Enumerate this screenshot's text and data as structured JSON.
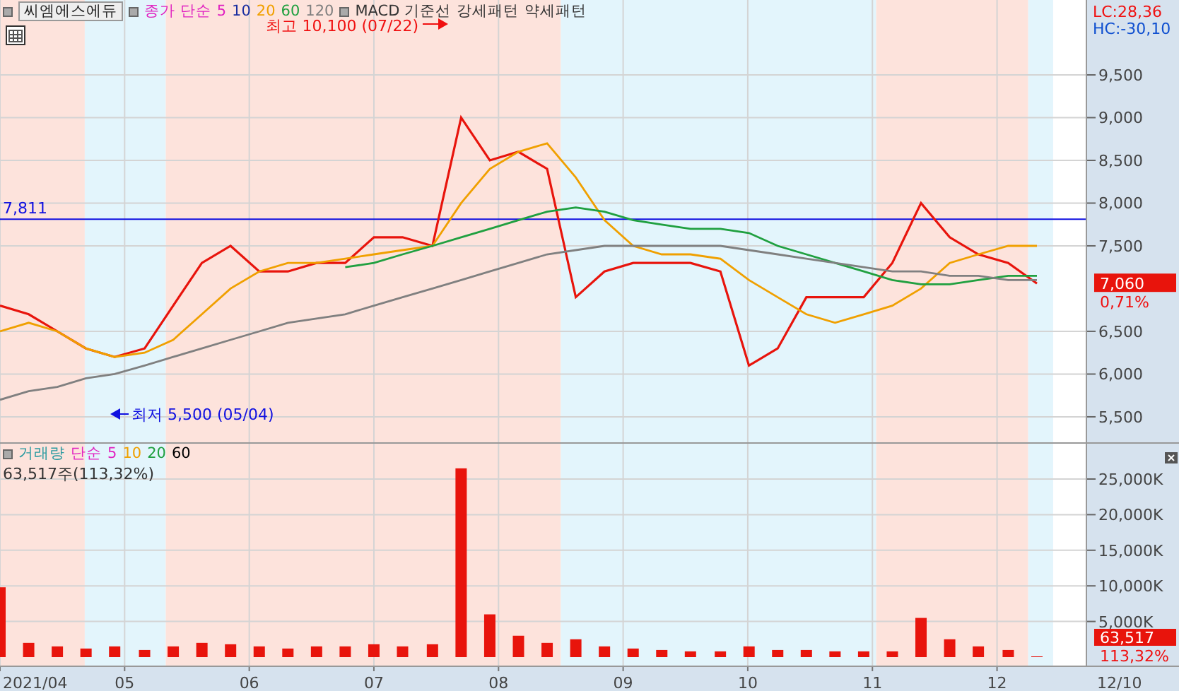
{
  "legend": {
    "stock": "씨엠에스에듀",
    "ma_label": "종가 단순",
    "periods": [
      {
        "label": "5",
        "color": "#e020c0"
      },
      {
        "label": "10",
        "color": "#1a2ea0"
      },
      {
        "label": "20",
        "color": "#f0a000"
      },
      {
        "label": "60",
        "color": "#20a040"
      },
      {
        "label": "120",
        "color": "#808080"
      }
    ],
    "indicators": [
      "MACD 기준선",
      "강세패턴",
      "약세패턴"
    ]
  },
  "price_pane": {
    "lc": "LC:28,36",
    "hc": "HC:-30,10",
    "price_tag": "7,060",
    "change": "0,71%",
    "chart_data": {
      "type": "line",
      "grid": true,
      "xlim": [
        4,
        13.46
      ],
      "ylim": [
        5202,
        10376
      ],
      "x": [
        4,
        4.23,
        4.46,
        4.69,
        4.92,
        5.16,
        5.39,
        5.62,
        5.85,
        6.08,
        6.31,
        6.54,
        6.77,
        7,
        7.23,
        7.47,
        7.7,
        7.93,
        8.16,
        8.39,
        8.62,
        8.85,
        9.08,
        9.31,
        9.54,
        9.78,
        10.01,
        10.24,
        10.47,
        10.7,
        10.93,
        11.16,
        11.39,
        11.62,
        11.85,
        12.09,
        12.32
      ],
      "yticks": [
        {
          "value": 5500,
          "label": "5,500"
        },
        {
          "value": 6000,
          "label": "6,000"
        },
        {
          "value": 6500,
          "label": "6,500"
        },
        {
          "value": 7500,
          "label": "7,500"
        },
        {
          "value": 8000,
          "label": "8,000"
        },
        {
          "value": 8500,
          "label": "8,500"
        },
        {
          "value": 9000,
          "label": "9,000"
        },
        {
          "value": 9500,
          "label": "9,500"
        }
      ],
      "series": [
        {
          "color": "#e8140c",
          "values": [
            6800,
            6700,
            6500,
            6300,
            6200,
            6300,
            6800,
            7300,
            7500,
            7200,
            7200,
            7300,
            7300,
            7600,
            7600,
            7500,
            9000,
            8500,
            8600,
            8400,
            6900,
            7200,
            7300,
            7300,
            7300,
            7200,
            6100,
            6300,
            6900,
            6900,
            6900,
            7300,
            8000,
            7600,
            7400,
            7300,
            7060
          ]
        },
        {
          "color": "#f0a000",
          "values": [
            6500,
            6600,
            6500,
            6300,
            6200,
            6250,
            6400,
            6700,
            7000,
            7200,
            7300,
            7300,
            7350,
            7400,
            7450,
            7500,
            8000,
            8400,
            8600,
            8700,
            8300,
            7800,
            7500,
            7400,
            7400,
            7350,
            7100,
            6900,
            6700,
            6600,
            6700,
            6800,
            7000,
            7300,
            7400,
            7500,
            7500
          ]
        },
        {
          "color": "#20a040",
          "values": [
            null,
            null,
            null,
            null,
            null,
            null,
            null,
            null,
            null,
            null,
            null,
            null,
            7250,
            7300,
            7400,
            7500,
            7600,
            7700,
            7800,
            7900,
            7950,
            7900,
            7800,
            7750,
            7700,
            7700,
            7650,
            7500,
            7400,
            7300,
            7200,
            7100,
            7050,
            7050,
            7100,
            7150,
            7150
          ]
        },
        {
          "color": "#808080",
          "values": [
            5700,
            5800,
            5850,
            5950,
            6000,
            6100,
            6200,
            6300,
            6400,
            6500,
            6600,
            6650,
            6700,
            6800,
            6900,
            7000,
            7100,
            7200,
            7300,
            7400,
            7450,
            7500,
            7500,
            7500,
            7500,
            7500,
            7450,
            7400,
            7350,
            7300,
            7250,
            7200,
            7200,
            7150,
            7150,
            7100,
            7100
          ]
        }
      ],
      "bands": [
        {
          "axis": "x",
          "from": 4,
          "to": 4.68,
          "color": "#fde3dc"
        },
        {
          "axis": "x",
          "from": 4.68,
          "to": 5.33,
          "color": "#e3f5fc"
        },
        {
          "axis": "x",
          "from": 5.33,
          "to": 8.5,
          "color": "#fde3dc"
        },
        {
          "axis": "x",
          "from": 8.5,
          "to": 11.03,
          "color": "#e3f5fc"
        },
        {
          "axis": "x",
          "from": 11.03,
          "to": 12.25,
          "color": "#fde3dc"
        },
        {
          "axis": "x",
          "from": 12.25,
          "to": 12.45,
          "color": "#e3f5fc"
        }
      ],
      "ref_lines": [
        {
          "axis": "y",
          "value": 7811,
          "label": "7,811",
          "color": "#1010e0"
        }
      ],
      "annotations": [
        "최고 10,100 (07/22)",
        "최저 5,500 (05/04)"
      ]
    }
  },
  "volume_pane": {
    "name": "거래량",
    "ma_label": "단순",
    "periods": [
      {
        "label": "5",
        "color": "#e020c0"
      },
      {
        "label": "10",
        "color": "#f0a000"
      },
      {
        "label": "20",
        "color": "#20a040"
      },
      {
        "label": "60",
        "color": "#000000"
      }
    ],
    "info": "63,517주(113,32%)",
    "volume_tag": "63,517",
    "ratio": "113,32%",
    "chart_data": {
      "type": "bar",
      "grid": true,
      "xlim": [
        4,
        13.46
      ],
      "ylim": [
        -1190,
        29960
      ],
      "x": [
        4,
        4.23,
        4.46,
        4.69,
        4.92,
        5.16,
        5.39,
        5.62,
        5.85,
        6.08,
        6.31,
        6.54,
        6.77,
        7,
        7.23,
        7.47,
        7.7,
        7.93,
        8.16,
        8.39,
        8.62,
        8.85,
        9.08,
        9.31,
        9.54,
        9.78,
        10.01,
        10.24,
        10.47,
        10.7,
        10.93,
        11.16,
        11.39,
        11.62,
        11.85,
        12.09,
        12.32
      ],
      "xticks": [
        {
          "value": 4,
          "label": "2021/04"
        },
        {
          "value": 5,
          "label": "05"
        },
        {
          "value": 6,
          "label": "06"
        },
        {
          "value": 7,
          "label": "07"
        },
        {
          "value": 8,
          "label": "08"
        },
        {
          "value": 9,
          "label": "09"
        },
        {
          "value": 10,
          "label": "10"
        },
        {
          "value": 11,
          "label": "11"
        },
        {
          "value": 12,
          "label": "12"
        }
      ],
      "yticks": [
        {
          "value": 5000,
          "label": "5,000K"
        },
        {
          "value": 10000,
          "label": "10,000K"
        },
        {
          "value": 15000,
          "label": "15,000K"
        },
        {
          "value": 20000,
          "label": "20,000K"
        },
        {
          "value": 25000,
          "label": "25,000K"
        }
      ],
      "bands": [
        {
          "axis": "x",
          "from": 4,
          "to": 4.68,
          "color": "#fde3dc"
        },
        {
          "axis": "x",
          "from": 4.68,
          "to": 5.33,
          "color": "#e3f5fc"
        },
        {
          "axis": "x",
          "from": 5.33,
          "to": 8.5,
          "color": "#fde3dc"
        },
        {
          "axis": "x",
          "from": 8.5,
          "to": 11.03,
          "color": "#e3f5fc"
        },
        {
          "axis": "x",
          "from": 11.03,
          "to": 12.25,
          "color": "#fde3dc"
        },
        {
          "axis": "x",
          "from": 12.25,
          "to": 12.45,
          "color": "#e3f5fc"
        }
      ],
      "series": [
        {
          "color": "#e8140c",
          "values": [
            9800,
            2000,
            1500,
            1200,
            1500,
            1000,
            1500,
            2000,
            1800,
            1500,
            1200,
            1500,
            1500,
            1800,
            1500,
            1800,
            26500,
            6000,
            3000,
            2000,
            2500,
            1500,
            1200,
            1000,
            800,
            800,
            1500,
            1000,
            1000,
            800,
            800,
            800,
            5500,
            2500,
            1500,
            1000,
            100
          ]
        }
      ]
    }
  },
  "date_axis": {
    "end_label": "12/10"
  }
}
